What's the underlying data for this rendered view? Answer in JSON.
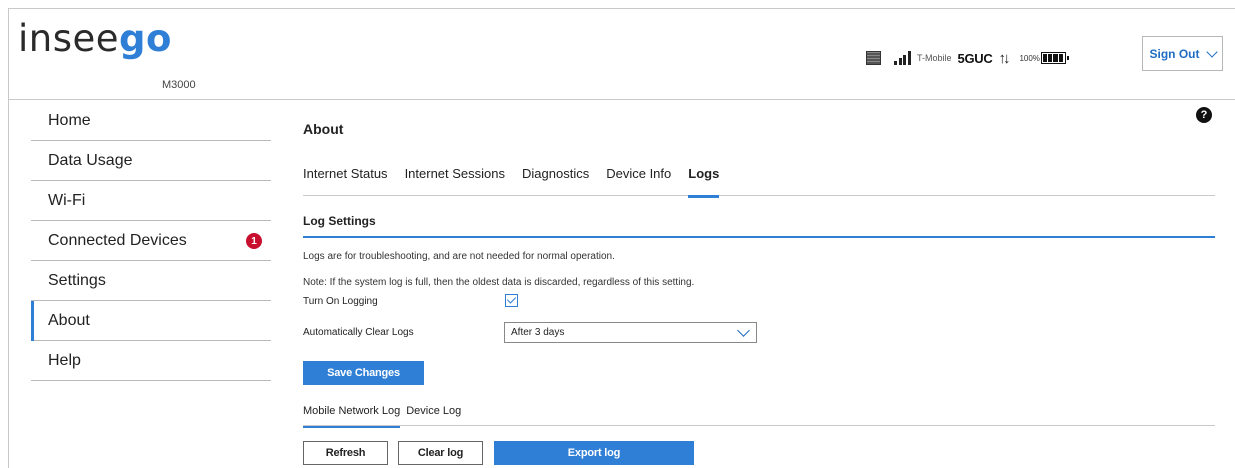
{
  "header": {
    "logo_left": "insee",
    "logo_right": "go",
    "model": "M3000",
    "carrier": "T-Mobile",
    "network_tech": "5GUC",
    "battery_percent": "100%",
    "signout_label": "Sign Out"
  },
  "sidebar": {
    "items": [
      {
        "label": "Home"
      },
      {
        "label": "Data Usage"
      },
      {
        "label": "Wi-Fi"
      },
      {
        "label": "Connected Devices",
        "badge": "1"
      },
      {
        "label": "Settings"
      },
      {
        "label": "About"
      },
      {
        "label": "Help"
      }
    ],
    "active": "About"
  },
  "main": {
    "title": "About",
    "help_glyph": "?",
    "tabs": [
      {
        "label": "Internet Status"
      },
      {
        "label": "Internet Sessions"
      },
      {
        "label": "Diagnostics"
      },
      {
        "label": "Device Info"
      },
      {
        "label": "Logs"
      }
    ],
    "active_tab": "Logs",
    "log_settings": {
      "title": "Log Settings",
      "info_1": "Logs are for troubleshooting, and are not needed for normal operation.",
      "info_2": "Note: If the system log is full, then the oldest data is discarded, regardless of this setting.",
      "logging_label": "Turn On Logging",
      "logging_enabled": true,
      "auto_clear_label": "Automatically Clear Logs",
      "auto_clear_value": "After 3 days",
      "save_label": "Save Changes"
    },
    "log_tabs": [
      {
        "label": "Mobile Network Log"
      },
      {
        "label": "Device Log"
      }
    ],
    "active_log_tab": "Mobile Network Log",
    "actions": {
      "refresh_label": "Refresh",
      "clear_label": "Clear log",
      "export_label": "Export log"
    }
  },
  "colors": {
    "accent": "#2f7fd6",
    "badge": "#c8102e"
  }
}
